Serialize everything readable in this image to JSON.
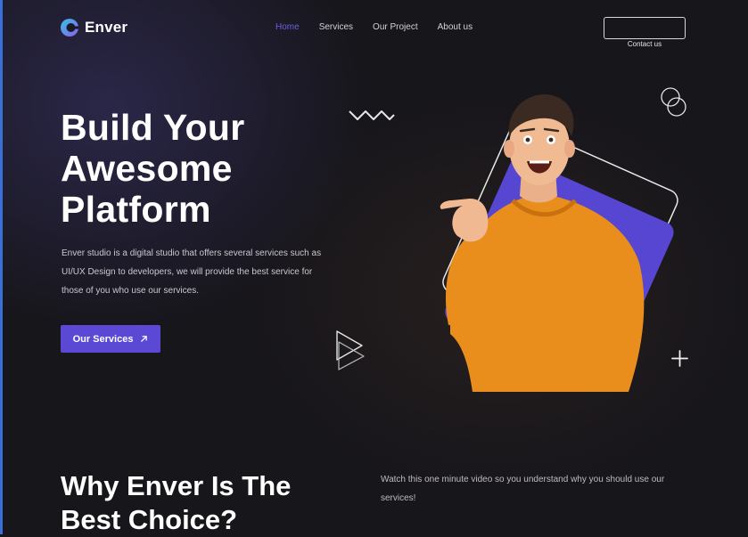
{
  "brand": {
    "name": "Enver",
    "logo_icon": "enver-logo-icon",
    "accent_color": "#5b48d4",
    "active_nav_color": "#6a5fe0"
  },
  "nav": {
    "items": [
      {
        "label": "Home",
        "active": true
      },
      {
        "label": "Services",
        "active": false
      },
      {
        "label": "Our Project",
        "active": false
      },
      {
        "label": "About us",
        "active": false
      }
    ],
    "contact_label": "Contact us"
  },
  "hero": {
    "title": "Build Your\nAwesome\nPlatform",
    "description": "Enver studio is a digital studio that offers several services such as UI/UX Design to developers, we will provide the best service for those of you who use our services.",
    "cta_label": "Our Services",
    "cta_icon": "arrow-up-right-icon"
  },
  "why": {
    "title": "Why Enver Is The\nBest Choice?",
    "description": "Watch this one minute video so you understand why you should use our services!"
  }
}
